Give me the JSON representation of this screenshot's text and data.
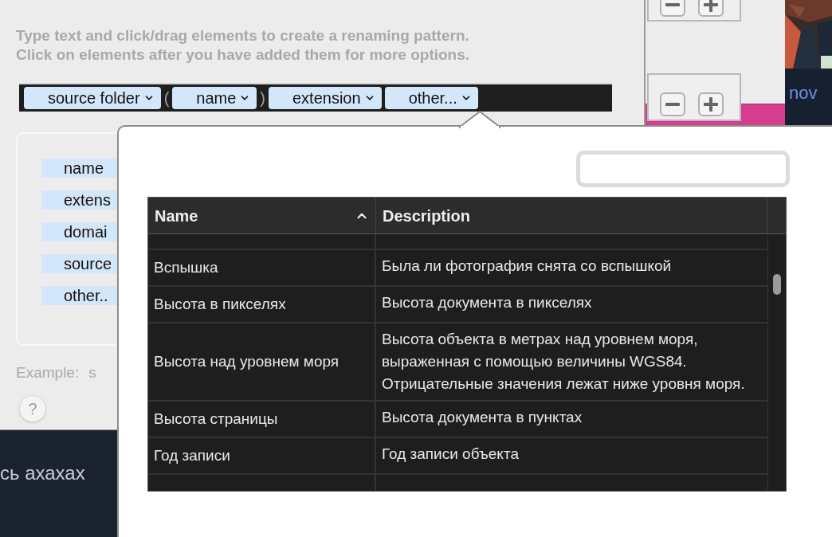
{
  "instructions": [
    "Type text and click/drag elements to create a renaming pattern.",
    "Click on elements after you have added them for more options."
  ],
  "pattern": [
    {
      "kind": "token",
      "label": "source folder"
    },
    {
      "kind": "text",
      "label": "("
    },
    {
      "kind": "token",
      "label": "name"
    },
    {
      "kind": "text",
      "label": ")"
    },
    {
      "kind": "token",
      "label": "extension"
    },
    {
      "kind": "token",
      "label": "other..."
    }
  ],
  "elements": [
    "name",
    "extens",
    "domai",
    "source",
    "other.."
  ],
  "example": {
    "label": "Example:",
    "value": "s"
  },
  "help": "?",
  "background_text": "сь ахахах",
  "side_text": "nov",
  "table": {
    "columns": [
      {
        "label": "Name",
        "sorted": true
      },
      {
        "label": "Description",
        "sorted": false
      }
    ],
    "rows": [
      {
        "name": "Вспышка",
        "description": "Была ли фотография снята со вспышкой"
      },
      {
        "name": "Высота в пикселях",
        "description": "Высота документа в пикселях"
      },
      {
        "name": "Высота над уровнем моря",
        "description": "Высота объекта в метрах над уровнем моря, выраженная с помощью величины WGS84. Отрицательные значения лежат ниже уровня моря."
      },
      {
        "name": "Высота страницы",
        "description": "Высота документа в пунктах"
      },
      {
        "name": "Год записи",
        "description": "Год записи объекта"
      }
    ]
  }
}
